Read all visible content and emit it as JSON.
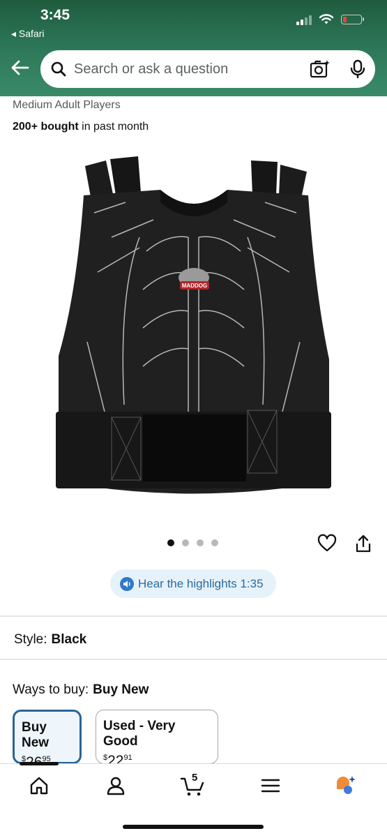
{
  "status_bar": {
    "time": "3:45",
    "back_app": "◂ Safari"
  },
  "search": {
    "placeholder": "Search or ask a question"
  },
  "product": {
    "subtitle": "Medium Adult Players",
    "bought_bold": "200+ bought",
    "bought_rest": " in past month",
    "image_count": 4,
    "active_image": 1,
    "logo_text": "MADDOG"
  },
  "audio": {
    "label": "Hear the highlights 1:35"
  },
  "style": {
    "label": "Style:",
    "value": "Black"
  },
  "ways_to_buy": {
    "label": "Ways to buy:",
    "value": "Buy New",
    "options": [
      {
        "label": "Buy New",
        "currency": "$",
        "dollars": "26",
        "cents": "95",
        "selected": true
      },
      {
        "label": "Used - Very Good",
        "currency": "$",
        "dollars": "22",
        "cents": "91",
        "selected": false
      }
    ]
  },
  "tabbar": {
    "cart_count": "5"
  },
  "colors": {
    "header_green": "#2e7a5a",
    "selected_blue": "#2a6496",
    "audio_blue": "#2c6a9e",
    "assistant_orange": "#f08c38",
    "assistant_blue": "#3d7be0"
  },
  "icons": [
    "search-icon",
    "camera-icon",
    "microphone-icon",
    "back-arrow-icon",
    "heart-icon",
    "share-icon",
    "speaker-icon",
    "home-icon",
    "account-icon",
    "cart-icon",
    "menu-icon",
    "assistant-icon"
  ]
}
